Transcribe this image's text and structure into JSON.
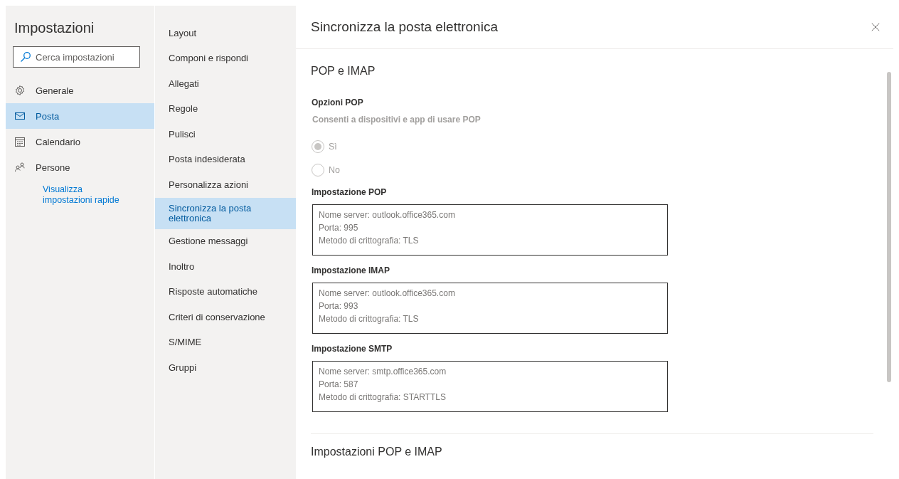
{
  "sidebar": {
    "title": "Impostazioni",
    "search": {
      "placeholder": "Cerca impostazioni"
    },
    "items": [
      {
        "label": "Generale",
        "kind": "gear",
        "selected": false
      },
      {
        "label": "Posta",
        "kind": "mail",
        "selected": true
      },
      {
        "label": "Calendario",
        "kind": "calendar",
        "selected": false
      },
      {
        "label": "Persone",
        "kind": "people",
        "selected": false
      }
    ],
    "link": "Visualizza impostazioni rapide"
  },
  "submenu": {
    "items": [
      {
        "label": "Layout",
        "selected": false
      },
      {
        "label": "Componi e rispondi",
        "selected": false
      },
      {
        "label": "Allegati",
        "selected": false
      },
      {
        "label": "Regole",
        "selected": false
      },
      {
        "label": "Pulisci",
        "selected": false
      },
      {
        "label": "Posta indesiderata",
        "selected": false
      },
      {
        "label": "Personalizza azioni",
        "selected": false
      },
      {
        "label": "Sincronizza la posta elettronica",
        "selected": true
      },
      {
        "label": "Gestione messaggi",
        "selected": false
      },
      {
        "label": "Inoltro",
        "selected": false
      },
      {
        "label": "Risposte automatiche",
        "selected": false
      },
      {
        "label": "Criteri di conservazione",
        "selected": false
      },
      {
        "label": "S/MIME",
        "selected": false
      },
      {
        "label": "Gruppi",
        "selected": false
      }
    ]
  },
  "panel": {
    "title": "Sincronizza la posta elettronica",
    "section_title": "POP e IMAP",
    "pop_options": {
      "label": "Opzioni POP",
      "question": "Consenti a dispositivi e app di usare POP",
      "disabled": true,
      "radios": [
        {
          "label": "Sì",
          "selected": true,
          "disabled": true
        },
        {
          "label": "No",
          "selected": false,
          "disabled": true
        }
      ]
    },
    "settings": [
      {
        "label": "Impostazione POP",
        "lines": [
          "Nome server: outlook.office365.com",
          "Porta: 995",
          "Metodo di crittografia: TLS"
        ]
      },
      {
        "label": "Impostazione IMAP",
        "lines": [
          "Nome server: outlook.office365.com",
          "Porta: 993",
          "Metodo di crittografia: TLS"
        ]
      },
      {
        "label": "Impostazione SMTP",
        "lines": [
          "Nome server: smtp.office365.com",
          "Porta: 587",
          "Metodo di crittografia: STARTTLS"
        ]
      }
    ],
    "next_section_title": "Impostazioni POP e IMAP"
  }
}
